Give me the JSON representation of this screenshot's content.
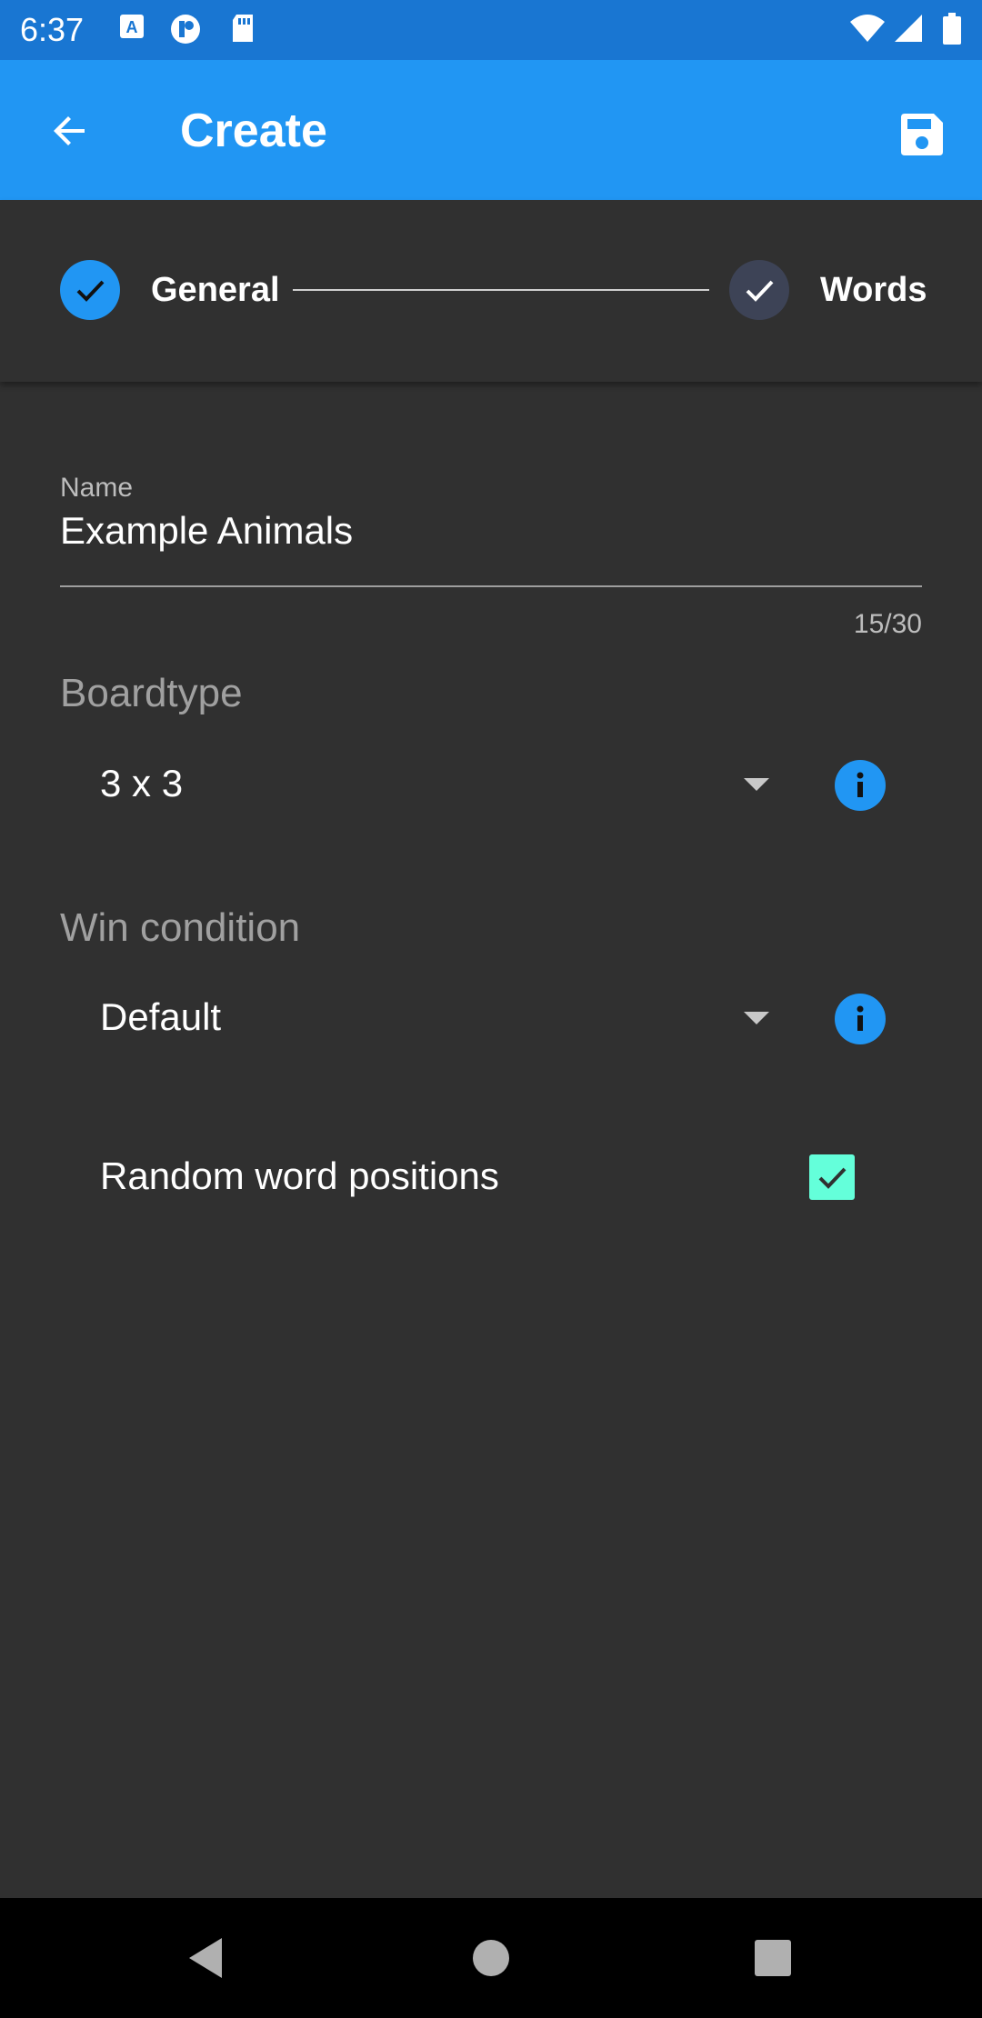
{
  "status_bar": {
    "time": "6:37",
    "icons": [
      "text-notification-icon",
      "app-notification-icon",
      "sd-card-icon",
      "wifi-icon",
      "signal-icon",
      "battery-icon"
    ]
  },
  "app_bar": {
    "title": "Create",
    "back_icon": "arrow-back-icon",
    "save_icon": "save-icon",
    "color": "#2196f3"
  },
  "stepper": {
    "steps": [
      {
        "label": "General",
        "state": "active-complete",
        "color": "#2196f3"
      },
      {
        "label": "Words",
        "state": "complete",
        "color": "#3d4356"
      }
    ]
  },
  "form": {
    "name_field": {
      "label": "Name",
      "value": "Example Animals",
      "counter": "15/30"
    },
    "boardtype": {
      "title": "Boardtype",
      "selected": "3 x 3"
    },
    "win_condition": {
      "title": "Win condition",
      "selected": "Default"
    },
    "random_positions": {
      "label": "Random word positions",
      "checked": true,
      "color": "#64ffda"
    }
  },
  "nav_bar": {
    "buttons": [
      "back-triangle-icon",
      "home-circle-icon",
      "recents-square-icon"
    ]
  }
}
